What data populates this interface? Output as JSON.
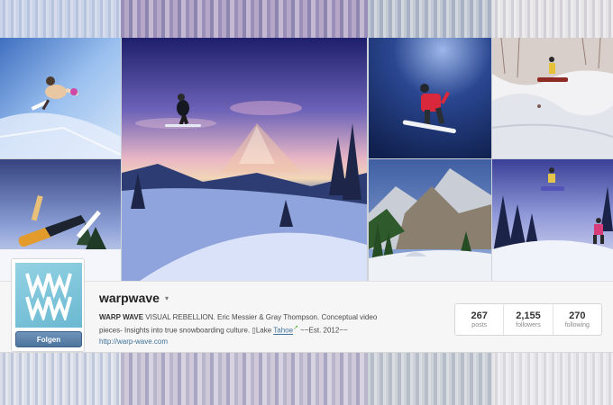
{
  "profile": {
    "username": "warpwave",
    "follow_label": "Folgen",
    "avatar_letters": "WW",
    "bio_bold": "WARP WAVE",
    "bio_part1": " VISUAL REBELLION. Eric Messier & Gray Thompson. Conceptual video pieces- Insights into true snowboarding culture. ▯",
    "bio_lake": "Lake ",
    "bio_tahoe": "Tahoe",
    "bio_ext_icon": "↗",
    "bio_part2": " ~~Est. 2012~~",
    "website": "http://warp-wave.com"
  },
  "stats": [
    {
      "value": "267",
      "label": "posts"
    },
    {
      "value": "2,155",
      "label": "followers"
    },
    {
      "value": "270",
      "label": "following"
    }
  ],
  "icons": {
    "caret": "▾"
  },
  "colors": {
    "link": "#3f729b",
    "follow_button": "#55799f",
    "avatar_bg": "#7fc6dc"
  }
}
